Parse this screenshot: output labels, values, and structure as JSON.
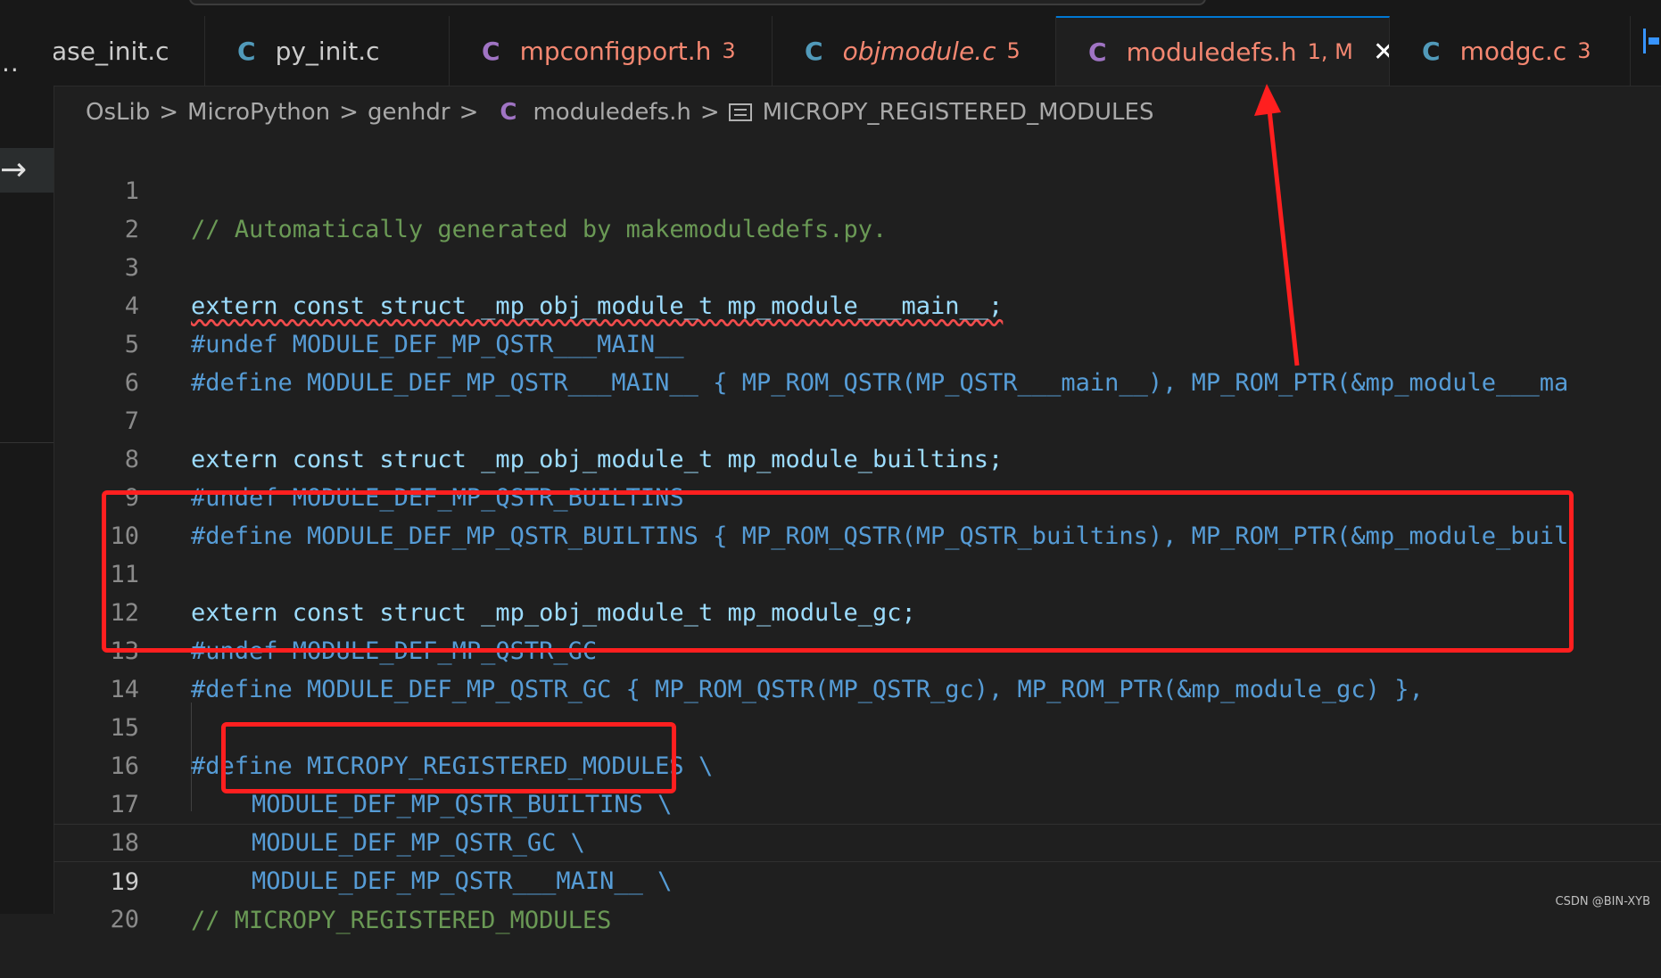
{
  "tabs": [
    {
      "name": "ase_init.c",
      "icon": "c-file-icon",
      "icon_color": "blue",
      "style": "normal",
      "badge": ""
    },
    {
      "name": "py_init.c",
      "icon": "c-file-icon",
      "icon_color": "blue",
      "style": "normal",
      "badge": ""
    },
    {
      "name": "mpconfigport.h",
      "icon": "c-file-icon",
      "icon_color": "purple",
      "style": "error",
      "badge": "3"
    },
    {
      "name": "objmodule.c",
      "icon": "c-file-icon",
      "icon_color": "blue",
      "style": "error-italic",
      "badge": "5"
    },
    {
      "name": "moduledefs.h",
      "icon": "c-file-icon",
      "icon_color": "purple",
      "style": "error",
      "badge": "1, M",
      "active": true
    },
    {
      "name": "modgc.c",
      "icon": "c-file-icon",
      "icon_color": "blue",
      "style": "error",
      "badge": "3"
    }
  ],
  "tab_icon_letter": "C",
  "close_glyph": "✕",
  "breadcrumb": {
    "items": [
      "OsLib",
      "MicroPython",
      "genhdr",
      "moduledefs.h",
      "MICROPY_REGISTERED_MODULES"
    ],
    "separator": ">"
  },
  "editor": {
    "current_line": 19,
    "lines": [
      {
        "n": "1",
        "text": "// Automatically generated by makemoduledefs.py."
      },
      {
        "n": "2",
        "text": ""
      },
      {
        "n": "3",
        "text": "extern const struct _mp_obj_module_t mp_module___main__;"
      },
      {
        "n": "4",
        "text": "#undef MODULE_DEF_MP_QSTR___MAIN__"
      },
      {
        "n": "5",
        "text": "#define MODULE_DEF_MP_QSTR___MAIN__ { MP_ROM_QSTR(MP_QSTR___main__), MP_ROM_PTR(&mp_module___ma"
      },
      {
        "n": "6",
        "text": ""
      },
      {
        "n": "7",
        "text": "extern const struct _mp_obj_module_t mp_module_builtins;"
      },
      {
        "n": "8",
        "text": "#undef MODULE_DEF_MP_QSTR_BUILTINS"
      },
      {
        "n": "9",
        "text": "#define MODULE_DEF_MP_QSTR_BUILTINS { MP_ROM_QSTR(MP_QSTR_builtins), MP_ROM_PTR(&mp_module_buil"
      },
      {
        "n": "10",
        "text": ""
      },
      {
        "n": "11",
        "text": "extern const struct _mp_obj_module_t mp_module_gc;"
      },
      {
        "n": "12",
        "text": "#undef MODULE_DEF_MP_QSTR_GC"
      },
      {
        "n": "13",
        "text": "#define MODULE_DEF_MP_QSTR_GC { MP_ROM_QSTR(MP_QSTR_gc), MP_ROM_PTR(&mp_module_gc) },"
      },
      {
        "n": "14",
        "text": ""
      },
      {
        "n": "15",
        "text": "#define MICROPY_REGISTERED_MODULES \\"
      },
      {
        "n": "16",
        "text": "MODULE_DEF_MP_QSTR_BUILTINS \\"
      },
      {
        "n": "17",
        "text": "MODULE_DEF_MP_QSTR_GC \\"
      },
      {
        "n": "18",
        "text": "MODULE_DEF_MP_QSTR___MAIN__ \\"
      },
      {
        "n": "19",
        "text": "// MICROPY_REGISTERED_MODULES"
      },
      {
        "n": "20",
        "text": ""
      }
    ]
  },
  "annotation_color": "#ff1f1f",
  "watermark": "CSDN @BIN-XYB"
}
